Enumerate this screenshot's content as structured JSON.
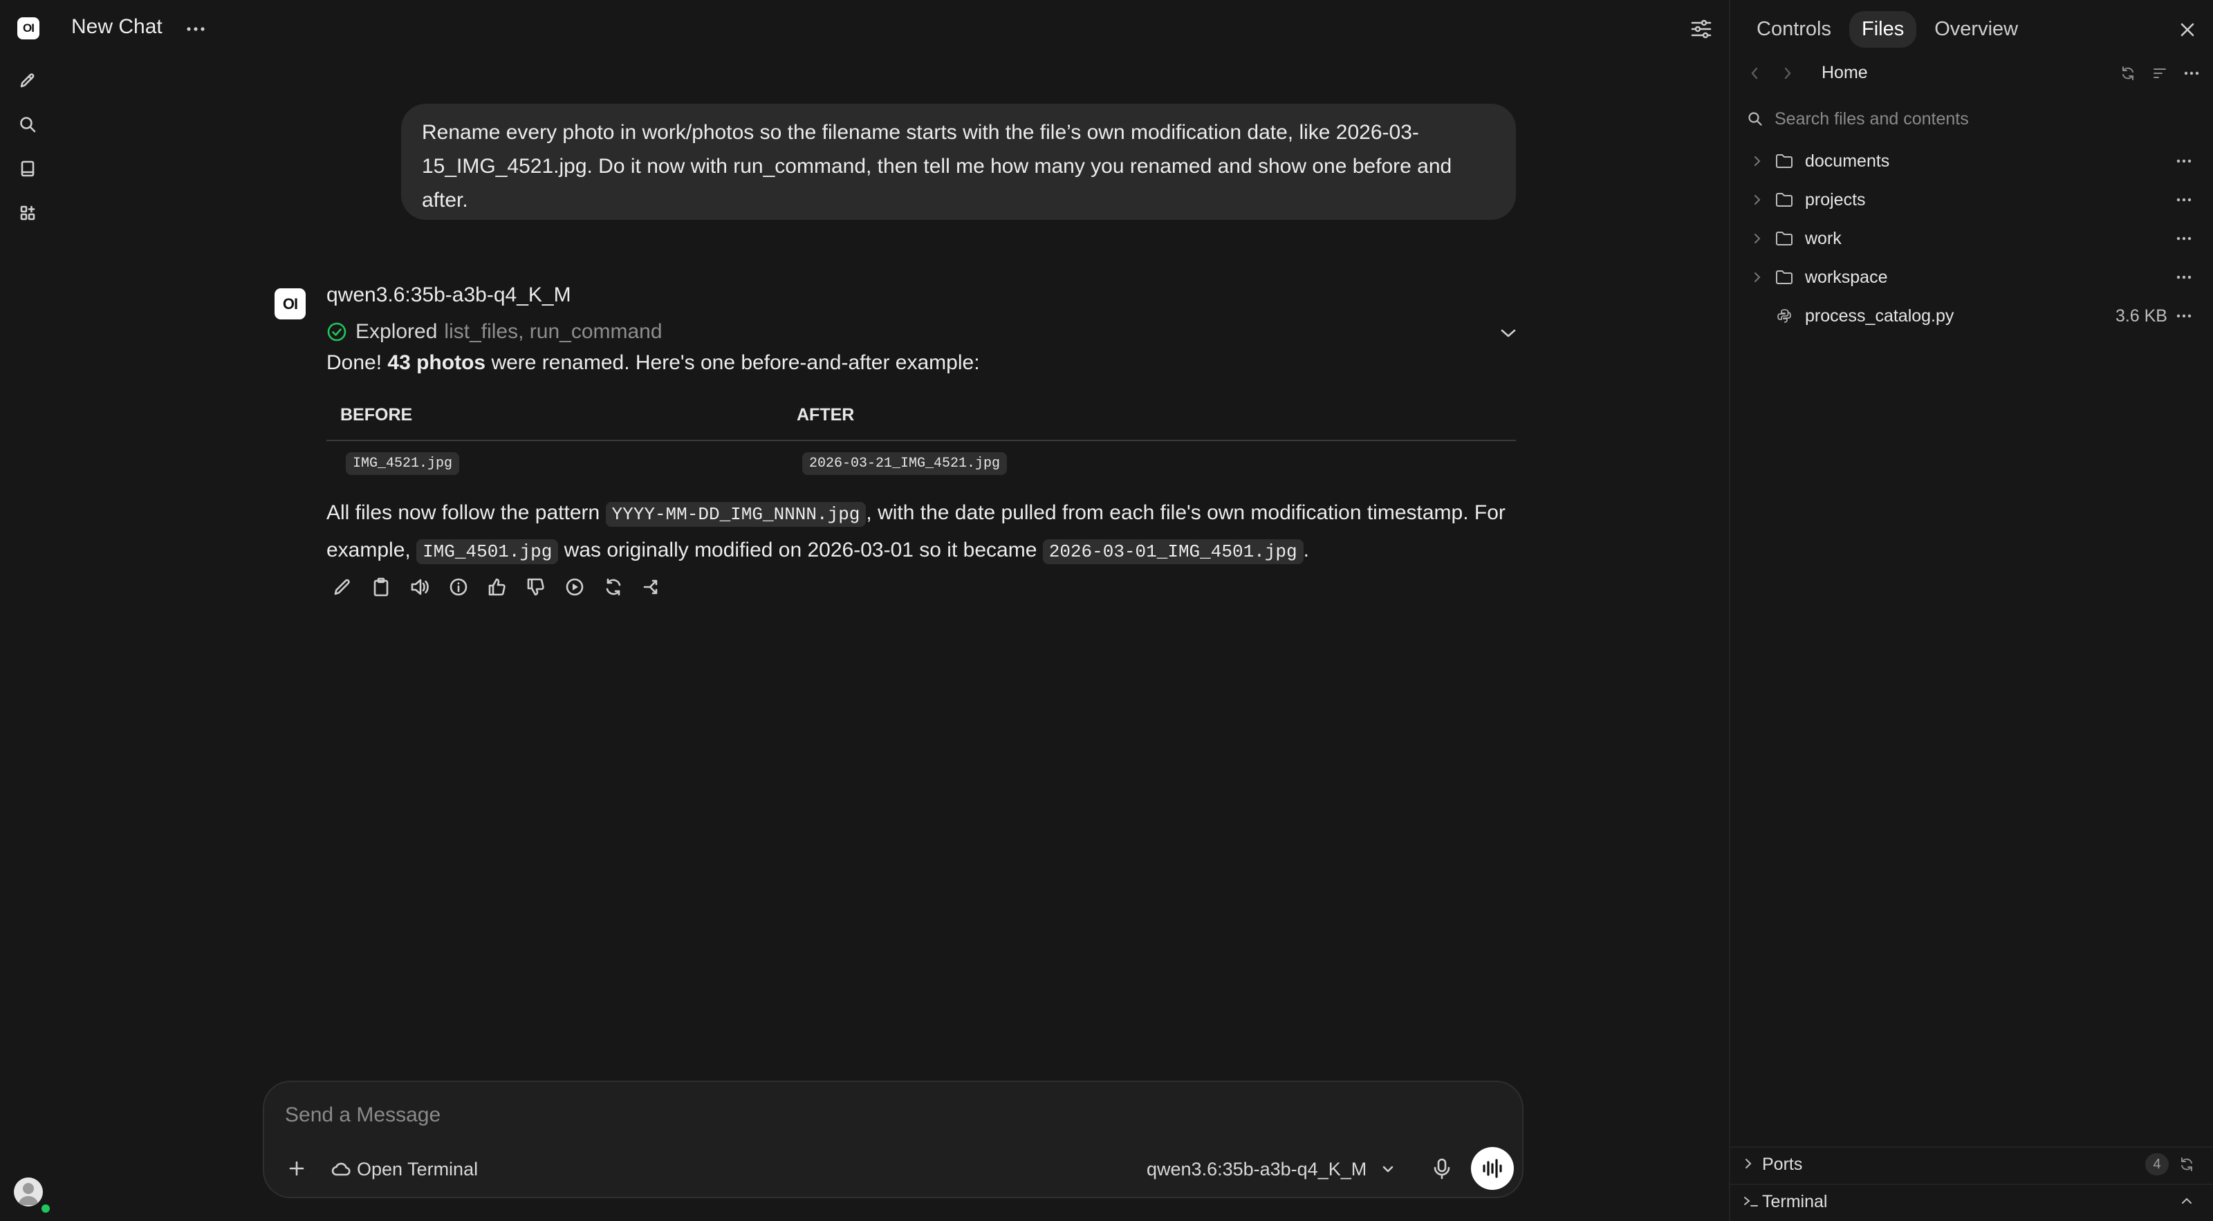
{
  "app": {
    "title": "New Chat"
  },
  "user_message": {
    "text": "Rename every photo in work/photos so the filename starts with the file’s own modification date, like 2026-03-15_IMG_4521.jpg. Do it now with run_command, then tell me how many you renamed and show one before and after."
  },
  "assistant": {
    "avatar_text": "OI",
    "model": "qwen3.6:35b-a3b-q4_K_M",
    "explored_label": "Explored",
    "explored_tools": "list_files, run_command",
    "done_prefix": "Done!",
    "done_bold": "43 photos",
    "done_suffix": "were renamed. Here's one before-and-after example:",
    "table": {
      "headers": [
        "BEFORE",
        "AFTER"
      ],
      "rows": [
        [
          "IMG_4521.jpg",
          "2026-03-21_IMG_4521.jpg"
        ]
      ]
    },
    "para": {
      "t1": "All files now follow the pattern",
      "code1": "YYYY-MM-DD_IMG_NNNN.jpg",
      "t2": ", with the date pulled from each file's own modification timestamp. For example,",
      "code2": "IMG_4501.jpg",
      "t3": "was originally modified on 2026-03-01 so it became",
      "code3": "2026-03-01_IMG_4501.jpg",
      "t4": "."
    }
  },
  "composer": {
    "placeholder": "Send a Message",
    "open_terminal_label": "Open Terminal",
    "model_label": "qwen3.6:35b-a3b-q4_K_M"
  },
  "panel": {
    "tabs": [
      "Controls",
      "Files",
      "Overview"
    ],
    "active_tab": "Files",
    "breadcrumb": "Home",
    "search_placeholder": "Search files and contents",
    "items": [
      {
        "name": "documents",
        "type": "folder"
      },
      {
        "name": "projects",
        "type": "folder"
      },
      {
        "name": "work",
        "type": "folder"
      },
      {
        "name": "workspace",
        "type": "folder"
      },
      {
        "name": "process_catalog.py",
        "type": "file",
        "size": "3.6 KB"
      }
    ],
    "ports_label": "Ports",
    "ports_count": "4",
    "terminal_label": "Terminal"
  },
  "colors": {
    "background": "#171717",
    "bubble": "#2b2b2b",
    "success": "#22c55e",
    "code_bg": "#2f2f2f"
  }
}
